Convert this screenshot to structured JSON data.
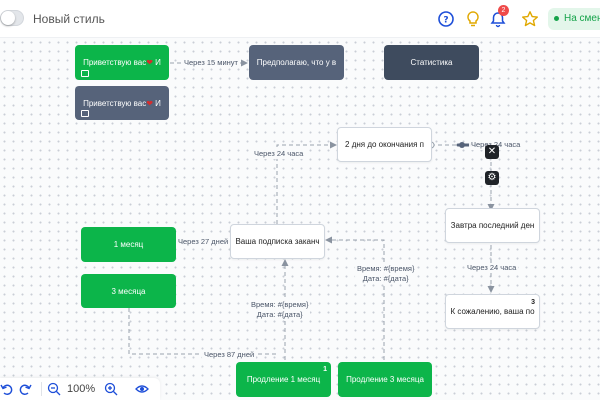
{
  "topbar": {
    "style_label": "Новый стиль",
    "notifications_count": "2",
    "status_label": "На смене"
  },
  "nodes": {
    "greet1": {
      "text": "Приветствую вас",
      "tail": "И"
    },
    "greet2": {
      "text": "Приветствую вас",
      "tail": "И"
    },
    "suppose": {
      "text": "Предполагаю, что у в"
    },
    "stats": {
      "text": "Статистика"
    },
    "two_days": {
      "text": "2 дня до окончания п"
    },
    "tomorrow": {
      "text": "Завтра последний ден"
    },
    "sorry": {
      "text": "К сожалению, ваша по",
      "count": "3"
    },
    "month1": {
      "text": "1 месяц"
    },
    "month3": {
      "text": "3 месяца"
    },
    "sub_ended": {
      "text": "Ваша подписка заканч"
    },
    "ext1": {
      "text": "Продление 1 месяц",
      "count": "1"
    },
    "ext3": {
      "text": "Продление 3 месяца"
    }
  },
  "edges": {
    "e15min": "Через 15 минут",
    "e24h_top": "Через 24 часа",
    "e24h_left": "Через 24 часа",
    "e24h_right": "Через 24 часа",
    "e27d": "Через 27 дней",
    "e87d": "Через 87 дней",
    "time_left_1": "Время: #{время}",
    "time_left_2": "Дата: #{дата}",
    "time_right_1": "Время: #{время}",
    "time_right_2": "Дата: #{дата}"
  },
  "bottombar": {
    "zoom": "100%"
  },
  "colors": {
    "green": "#0cb54a",
    "slate": "#56637a",
    "dark": "#3e4b5e",
    "accent": "#3b82f6",
    "status": "#16a34a"
  },
  "icons": [
    "help-icon",
    "lightbulb-icon",
    "bell-icon",
    "star-icon",
    "close-icon",
    "gear-icon",
    "undo-icon",
    "redo-icon",
    "zoom-out-icon",
    "zoom-in-icon",
    "eye-icon",
    "message-icon",
    "heart-icon"
  ]
}
